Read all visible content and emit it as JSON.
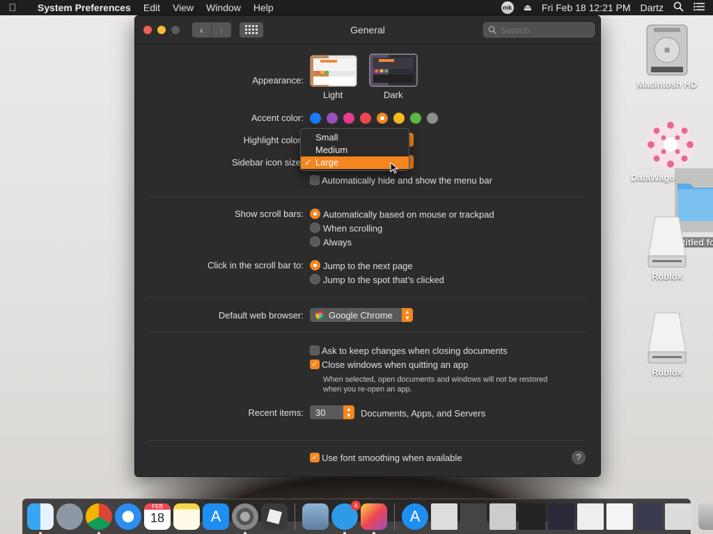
{
  "menubar": {
    "app_name": "System Preferences",
    "menus": [
      "Edit",
      "View",
      "Window",
      "Help"
    ],
    "mk_label": "mk",
    "datetime": "Fri Feb 18  12:21 PM",
    "user": "Dartz"
  },
  "window": {
    "title": "General",
    "search_placeholder": "Search"
  },
  "appearance": {
    "label": "Appearance:",
    "options": [
      {
        "name": "Light",
        "selected": false
      },
      {
        "name": "Dark",
        "selected": true
      }
    ]
  },
  "accent": {
    "label": "Accent color:",
    "colors": [
      "#1a7cf5",
      "#9b4fc0",
      "#e83a8e",
      "#ef4650",
      "#f5861f",
      "#f7bc1e",
      "#5ab840",
      "#8e8e8e"
    ],
    "selected_index": 4
  },
  "highlight": {
    "label": "Highlight color"
  },
  "sidebar_size": {
    "label": "Sidebar icon size",
    "options": [
      "Small",
      "Medium",
      "Large"
    ],
    "selected": "Large"
  },
  "menubar_autohide": {
    "label": "Automatically hide and show the menu bar",
    "checked": false
  },
  "scroll_bars": {
    "label": "Show scroll bars:",
    "options": [
      {
        "text": "Automatically based on mouse or trackpad",
        "selected": true
      },
      {
        "text": "When scrolling",
        "selected": false
      },
      {
        "text": "Always",
        "selected": false
      }
    ]
  },
  "scroll_click": {
    "label": "Click in the scroll bar to:",
    "options": [
      {
        "text": "Jump to the next page",
        "selected": true
      },
      {
        "text": "Jump to the spot that’s clicked",
        "selected": false
      }
    ]
  },
  "browser": {
    "label": "Default web browser:",
    "value": "Google Chrome"
  },
  "documents": {
    "ask_keep": {
      "text": "Ask to keep changes when closing documents",
      "checked": false
    },
    "close_windows": {
      "text": "Close windows when quitting an app",
      "checked": true
    },
    "note_line1": "When selected, open documents and windows will not be restored",
    "note_line2": "when you re-open an app."
  },
  "recent": {
    "label": "Recent items:",
    "value": "30",
    "suffix": "Documents, Apps, and Servers"
  },
  "font_smoothing": {
    "text": "Use font smoothing when available",
    "checked": true
  },
  "help_label": "?",
  "desktop": {
    "icons": [
      "Macintosh HD",
      "DataWago",
      "untitled fo",
      "Roblox",
      "Roblox"
    ]
  },
  "dock": {
    "apps": [
      "Finder",
      "Launchpad",
      "Google Chrome",
      "Safari",
      "Calendar",
      "Notes",
      "App Store",
      "System Preferences",
      "Roblox",
      "Preview",
      "mk",
      "Grapher",
      "App Store",
      "Photo",
      "Window",
      "Window",
      "Window",
      "Window",
      "Window",
      "Window",
      "Window",
      "Window",
      "Trash"
    ],
    "calendar_month": "FEB",
    "calendar_day": "18",
    "mk_badge": "4"
  }
}
